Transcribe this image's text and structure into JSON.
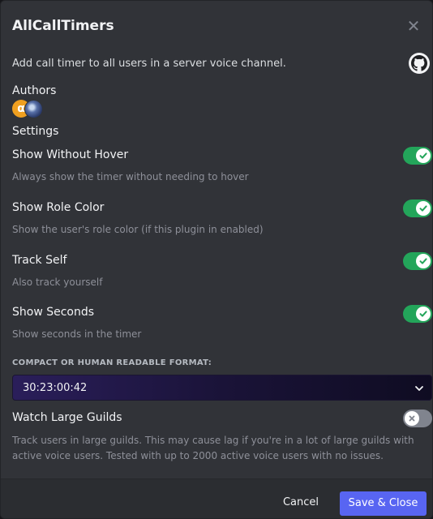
{
  "modal": {
    "title": "AllCallTimers",
    "close_icon": "close-icon",
    "description": "Add call timer to all users in a server voice channel.",
    "github_icon": "github-icon"
  },
  "authors": {
    "heading": "Authors",
    "avatars": [
      {
        "letter": "α",
        "color": "#f0a020"
      },
      {
        "icon": "avatar-image",
        "color": "#5870a8"
      }
    ]
  },
  "settings": {
    "heading": "Settings",
    "items": [
      {
        "label": "Show Without Hover",
        "note": "Always show the timer without needing to hover",
        "enabled": true
      },
      {
        "label": "Show Role Color",
        "note": "Show the user's role color (if this plugin in enabled)",
        "enabled": true
      },
      {
        "label": "Track Self",
        "note": "Also track yourself",
        "enabled": true
      },
      {
        "label": "Show Seconds",
        "note": "Show seconds in the timer",
        "enabled": true
      }
    ],
    "format": {
      "heading": "COMPACT OR HUMAN READABLE FORMAT:",
      "selected": "30:23:00:42"
    },
    "large_guilds": {
      "label": "Watch Large Guilds",
      "note": "Track users in large guilds. This may cause lag if you're in a lot of large guilds with active voice users. Tested with up to 2000 active voice users with no issues.",
      "enabled": false
    }
  },
  "footer": {
    "cancel_label": "Cancel",
    "save_label": "Save & Close"
  },
  "colors": {
    "toggle_on": "#23a55a",
    "toggle_off": "#80848e",
    "primary": "#5865f2"
  }
}
